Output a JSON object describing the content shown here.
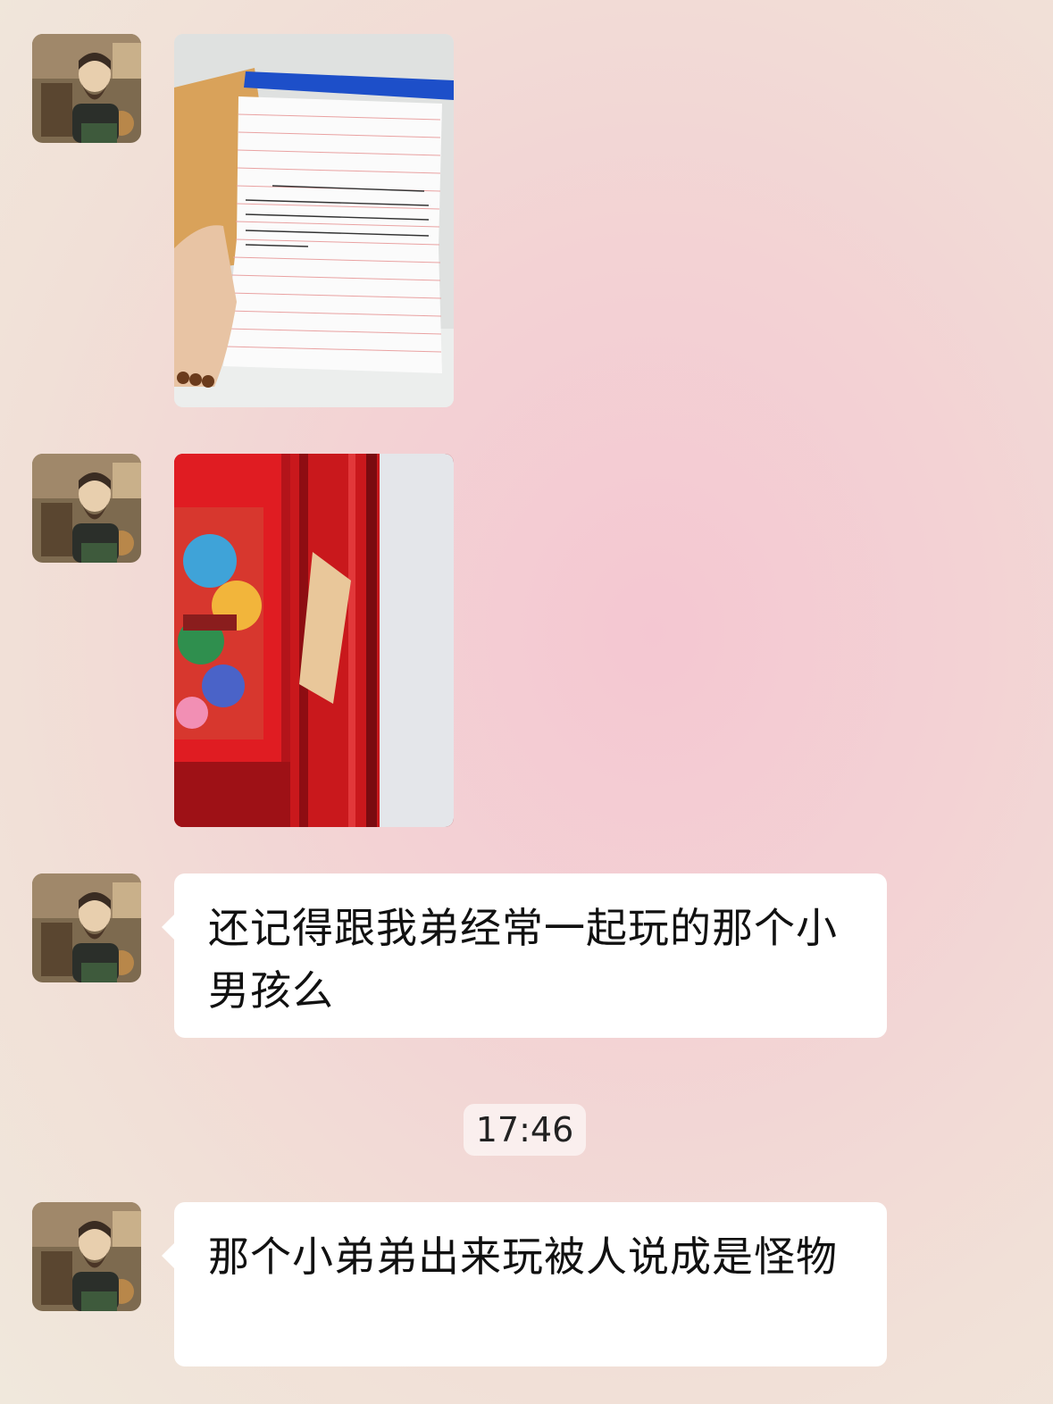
{
  "chat": {
    "messages": [
      {
        "type": "image",
        "description": "handwritten letter photo"
      },
      {
        "type": "image",
        "description": "envelope on red door photo"
      },
      {
        "type": "text",
        "text": "还记得跟我弟经常一起玩的那个小男孩么"
      },
      {
        "type": "text",
        "text": "那个小弟弟出来玩被人说成是怪物"
      }
    ],
    "timestamp": "17:46"
  },
  "colors": {
    "bubble": "#ffffff",
    "background_center": "#f4c7d2",
    "door_red": "#c0161a"
  },
  "icons": {
    "avatar": "bearded-man-avatar-icon"
  }
}
